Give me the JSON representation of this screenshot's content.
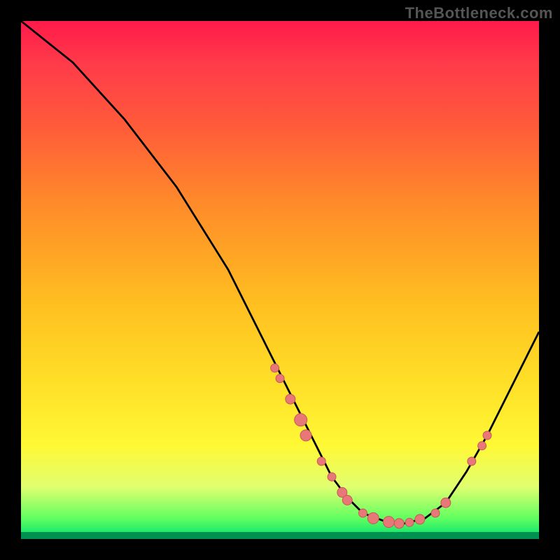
{
  "attribution": "TheBottleneck.com",
  "chart_data": {
    "type": "line",
    "title": "",
    "xlabel": "",
    "ylabel": "",
    "xlim": [
      0,
      100
    ],
    "ylim": [
      0,
      100
    ],
    "curve": [
      {
        "x": 0,
        "y": 100
      },
      {
        "x": 5,
        "y": 96
      },
      {
        "x": 10,
        "y": 92
      },
      {
        "x": 20,
        "y": 81
      },
      {
        "x": 30,
        "y": 68
      },
      {
        "x": 40,
        "y": 52
      },
      {
        "x": 47,
        "y": 38
      },
      {
        "x": 52,
        "y": 28
      },
      {
        "x": 56,
        "y": 20
      },
      {
        "x": 60,
        "y": 12
      },
      {
        "x": 63,
        "y": 8
      },
      {
        "x": 66,
        "y": 5
      },
      {
        "x": 70,
        "y": 3.5
      },
      {
        "x": 74,
        "y": 3
      },
      {
        "x": 78,
        "y": 4
      },
      {
        "x": 82,
        "y": 7
      },
      {
        "x": 86,
        "y": 13
      },
      {
        "x": 90,
        "y": 20
      },
      {
        "x": 95,
        "y": 30
      },
      {
        "x": 100,
        "y": 40
      }
    ],
    "markers": [
      {
        "x": 49,
        "y": 33,
        "size": 6
      },
      {
        "x": 50,
        "y": 31,
        "size": 6
      },
      {
        "x": 52,
        "y": 27,
        "size": 7
      },
      {
        "x": 54,
        "y": 23,
        "size": 9
      },
      {
        "x": 55,
        "y": 20,
        "size": 8
      },
      {
        "x": 58,
        "y": 15,
        "size": 6
      },
      {
        "x": 60,
        "y": 12,
        "size": 6
      },
      {
        "x": 62,
        "y": 9,
        "size": 7
      },
      {
        "x": 63,
        "y": 7.5,
        "size": 7
      },
      {
        "x": 66,
        "y": 5,
        "size": 6
      },
      {
        "x": 68,
        "y": 4,
        "size": 8
      },
      {
        "x": 71,
        "y": 3.3,
        "size": 8
      },
      {
        "x": 73,
        "y": 3,
        "size": 7
      },
      {
        "x": 75,
        "y": 3.2,
        "size": 6
      },
      {
        "x": 77,
        "y": 3.8,
        "size": 7
      },
      {
        "x": 80,
        "y": 5,
        "size": 6
      },
      {
        "x": 82,
        "y": 7,
        "size": 7
      },
      {
        "x": 87,
        "y": 15,
        "size": 6
      },
      {
        "x": 89,
        "y": 18,
        "size": 6
      },
      {
        "x": 90,
        "y": 20,
        "size": 6
      }
    ]
  }
}
